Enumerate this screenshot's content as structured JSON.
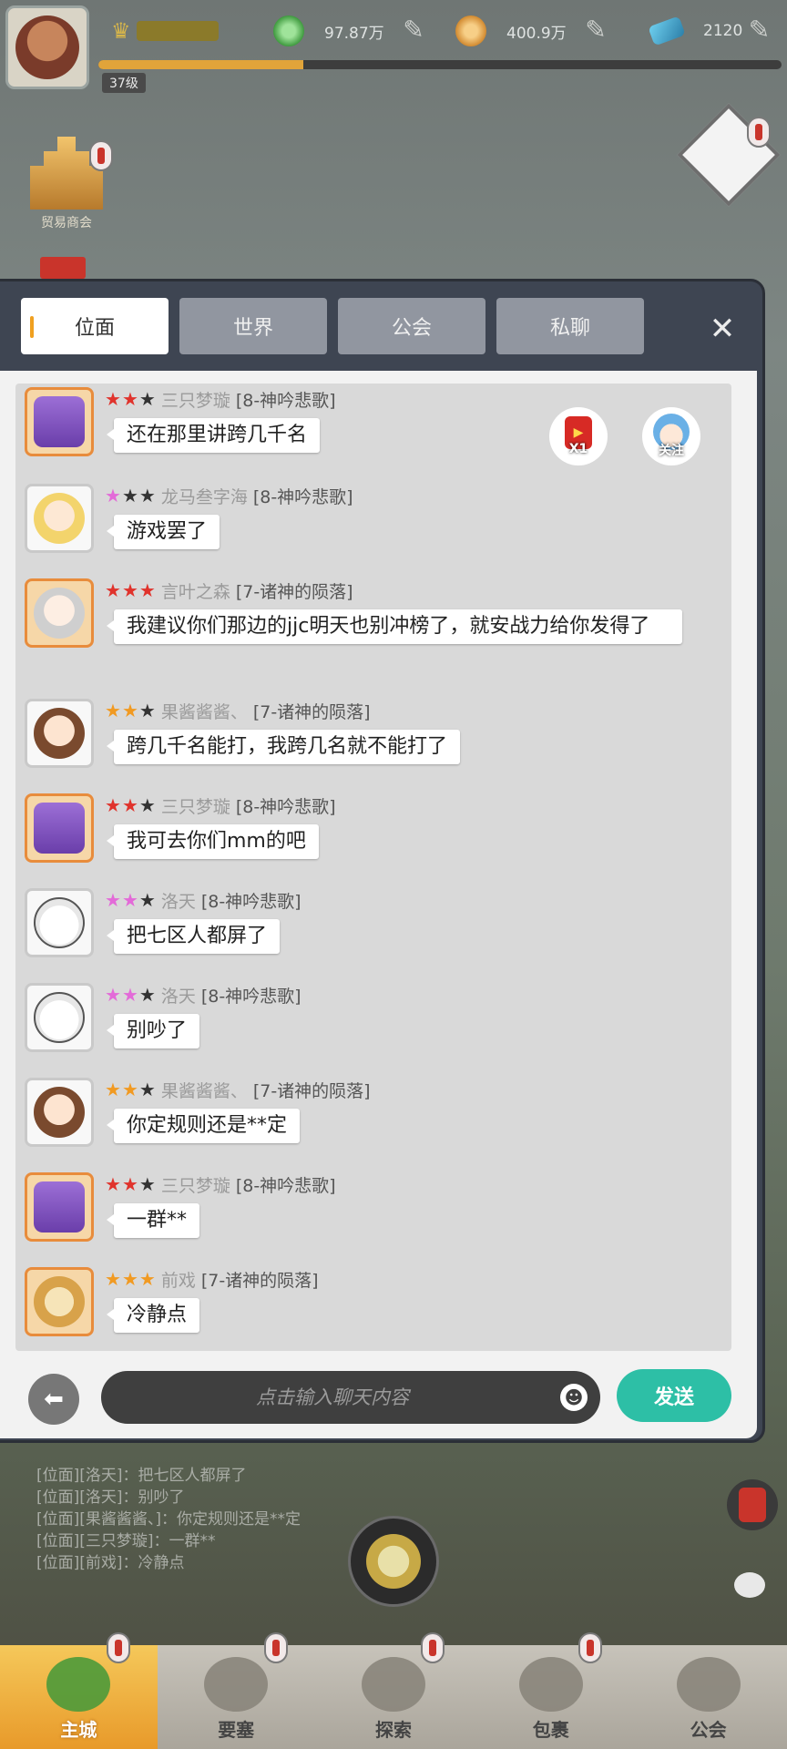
{
  "topbar": {
    "level": "37级",
    "xp_fraction": 0.3,
    "resources": [
      {
        "name": "green-gem",
        "value": "97.87万"
      },
      {
        "name": "gold-coin",
        "value": "400.9万"
      },
      {
        "name": "blue-diamond",
        "value": "2120"
      }
    ]
  },
  "side": {
    "castle_label": "贸易商会"
  },
  "chat": {
    "tabs": [
      "位面",
      "世界",
      "公会",
      "私聊"
    ],
    "active_tab": "位面",
    "close_icon": "close-icon",
    "redpack_label": "X1",
    "follow_label": "关注",
    "messages": [
      {
        "stars": [
          "red",
          "red",
          "dark"
        ],
        "name": "三只梦璇",
        "server": "[8-神吟悲歌]",
        "text": "还在那里讲跨几千名",
        "avatar": "purple"
      },
      {
        "stars": [
          "pink",
          "dark",
          "dark"
        ],
        "name": "龙马叁字海",
        "server": "[8-神吟悲歌]",
        "text": "游戏罢了",
        "avatar": "blonde"
      },
      {
        "stars": [
          "red",
          "red",
          "red"
        ],
        "name": "言叶之森",
        "server": "[7-诸神的陨落]",
        "text": "我建议你们那边的jjc明天也别冲榜了，就安战力给你发得了",
        "avatar": "silver"
      },
      {
        "stars": [
          "orange",
          "orange",
          "dark"
        ],
        "name": "果酱酱酱、",
        "server": "[7-诸神的陨落]",
        "text": "跨几千名能打，我跨几名就不能打了",
        "avatar": "brown"
      },
      {
        "stars": [
          "red",
          "red",
          "dark"
        ],
        "name": "三只梦璇",
        "server": "[8-神吟悲歌]",
        "text": "我可去你们mm的吧",
        "avatar": "purple"
      },
      {
        "stars": [
          "pink",
          "pink",
          "dark"
        ],
        "name": "洛天",
        "server": "[8-神吟悲歌]",
        "text": "把七区人都屏了",
        "avatar": "rabbit"
      },
      {
        "stars": [
          "pink",
          "pink",
          "dark"
        ],
        "name": "洛天",
        "server": "[8-神吟悲歌]",
        "text": "别吵了",
        "avatar": "rabbit"
      },
      {
        "stars": [
          "orange",
          "orange",
          "dark"
        ],
        "name": "果酱酱酱、",
        "server": "[7-诸神的陨落]",
        "text": "你定规则还是**定",
        "avatar": "brown"
      },
      {
        "stars": [
          "red",
          "red",
          "dark"
        ],
        "name": "三只梦璇",
        "server": "[8-神吟悲歌]",
        "text": "一群**",
        "avatar": "purple"
      },
      {
        "stars": [
          "orange",
          "orange",
          "orange"
        ],
        "name": "前戏",
        "server": "[7-诸神的陨落]",
        "text": "冷静点",
        "avatar": "cat"
      }
    ],
    "input_placeholder": "点击输入聊天内容",
    "send_label": "发送"
  },
  "background_log": [
    "[位面][洛天]：把七区人都屏了",
    "[位面][洛天]：别吵了",
    "[位面][果酱酱酱、]：你定规则还是**定",
    "[位面][三只梦璇]：一群**",
    "[位面][前戏]：冷静点"
  ],
  "bottom_nav": [
    "主城",
    "要塞",
    "探索",
    "包裹",
    "公会"
  ],
  "colors": {
    "send_button": "#2dbfa6",
    "active_tab_accent": "#f0a020",
    "panel": "#3e4552"
  }
}
